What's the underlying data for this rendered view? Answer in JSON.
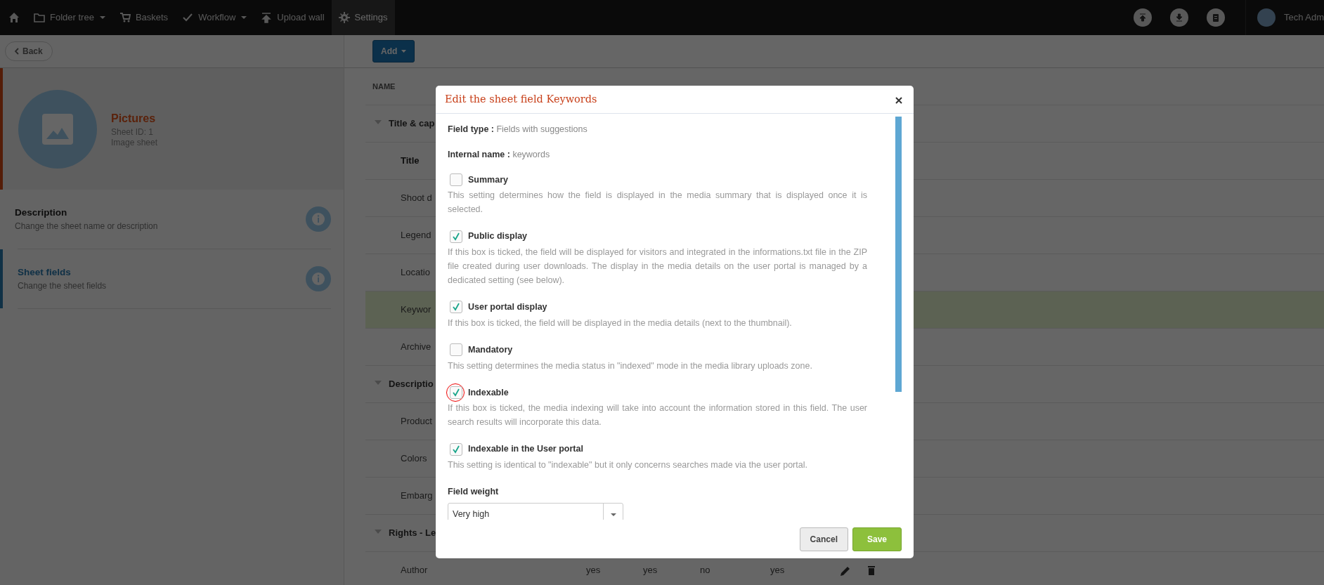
{
  "navbar": {
    "items": [
      {
        "label": "Folder tree",
        "dropdown": true,
        "selected": false
      },
      {
        "label": "Baskets",
        "dropdown": false,
        "selected": false
      },
      {
        "label": "Workflow",
        "dropdown": true,
        "selected": false
      },
      {
        "label": "Upload wall",
        "dropdown": false,
        "selected": false
      },
      {
        "label": "Settings",
        "dropdown": false,
        "selected": true
      }
    ],
    "user": {
      "name": "Tech Adm"
    }
  },
  "sidebar": {
    "back_button": "Back",
    "sheet": {
      "title": "Pictures",
      "id_line": "Sheet ID: 1",
      "type": "Image sheet"
    },
    "sections": [
      {
        "title": "Description",
        "subtitle": "Change the sheet name or description",
        "selected": false
      },
      {
        "title": "Sheet fields",
        "subtitle": "Change the sheet fields",
        "selected": true
      }
    ]
  },
  "content": {
    "add_button": "Add",
    "table": {
      "columns": [
        {
          "label": "NAME"
        }
      ],
      "rows": [
        {
          "kind": "group",
          "name": "Title & cap",
          "expanded": true
        },
        {
          "kind": "field",
          "name": "Title",
          "primary": true,
          "selected": false
        },
        {
          "kind": "field",
          "name": "Shoot d",
          "primary": false,
          "selected": false
        },
        {
          "kind": "field",
          "name": "Legend",
          "primary": false,
          "selected": false
        },
        {
          "kind": "field",
          "name": "Locatio",
          "primary": false,
          "selected": false
        },
        {
          "kind": "field",
          "name": "Keywor",
          "primary": false,
          "selected": true
        },
        {
          "kind": "field",
          "name": "Archive",
          "primary": false,
          "selected": false
        },
        {
          "kind": "group",
          "name": "Descriptio",
          "expanded": true
        },
        {
          "kind": "field",
          "name": "Product",
          "primary": false,
          "selected": false
        },
        {
          "kind": "field",
          "name": "Colors",
          "primary": false,
          "selected": false
        },
        {
          "kind": "field",
          "name": "Embarg",
          "primary": false,
          "selected": false
        },
        {
          "kind": "group",
          "name": "Rights - Le",
          "expanded": true
        },
        {
          "kind": "field",
          "name": "Author",
          "primary": false,
          "selected": false,
          "cells": [
            "yes",
            "yes",
            "no",
            "yes"
          ],
          "actions": true
        }
      ]
    }
  },
  "modal": {
    "title": "Edit the sheet field Keywords",
    "info": [
      {
        "label": "Field type :",
        "value": "Fields with suggestions"
      },
      {
        "label": "Internal name :",
        "value": "keywords"
      }
    ],
    "options": [
      {
        "label": "Summary",
        "checked": false,
        "highlighted": false,
        "description": "This setting determines how the field is displayed in the media summary that is displayed once it is selected."
      },
      {
        "label": "Public display",
        "checked": true,
        "highlighted": false,
        "description": "If this box is ticked, the field will be displayed for visitors and integrated in the informations.txt file in the ZIP file created during user downloads. The display in the media details on the user portal is managed by a dedicated setting (see below)."
      },
      {
        "label": "User portal display",
        "checked": true,
        "highlighted": false,
        "description": "If this box is ticked, the field will be displayed in the media details (next to the thumbnail)."
      },
      {
        "label": "Mandatory",
        "checked": false,
        "highlighted": false,
        "description": "This setting determines the media status in \"indexed\" mode in the media library uploads zone."
      },
      {
        "label": "Indexable",
        "checked": true,
        "highlighted": true,
        "description": "If this box is ticked, the media indexing will take into account the information stored in this field. The user search results will incorporate this data."
      },
      {
        "label": "Indexable in the User portal",
        "checked": true,
        "highlighted": false,
        "description": "This setting is identical to \"indexable\" but it only concerns searches made via the user portal."
      }
    ],
    "weight": {
      "label": "Field weight",
      "value": "Very high"
    },
    "buttons": [
      {
        "label": "Cancel",
        "kind": "secondary"
      },
      {
        "label": "Save",
        "kind": "primary"
      }
    ]
  }
}
